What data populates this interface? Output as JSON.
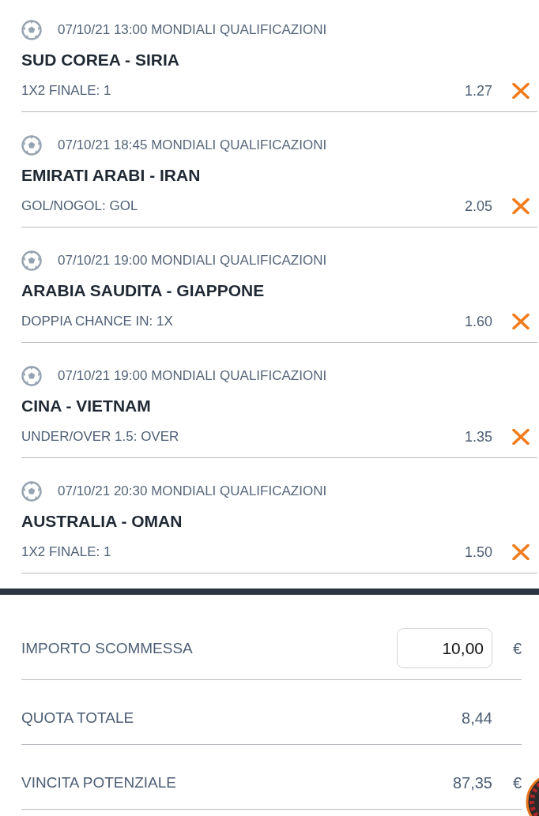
{
  "bets": [
    {
      "event": "07/10/21 13:00 MONDIALI QUALIFICAZIONI",
      "match": "SUD COREA - SIRIA",
      "market": "1X2 FINALE: 1",
      "odds": "1.27"
    },
    {
      "event": "07/10/21 18:45 MONDIALI QUALIFICAZIONI",
      "match": "EMIRATI ARABI - IRAN",
      "market": "GOL/NOGOL: GOL",
      "odds": "2.05"
    },
    {
      "event": "07/10/21 19:00 MONDIALI QUALIFICAZIONI",
      "match": "ARABIA SAUDITA - GIAPPONE",
      "market": "DOPPIA CHANCE IN: 1X",
      "odds": "1.60"
    },
    {
      "event": "07/10/21 19:00 MONDIALI QUALIFICAZIONI",
      "match": "CINA - VIETNAM",
      "market": "UNDER/OVER 1.5: OVER",
      "odds": "1.35"
    },
    {
      "event": "07/10/21 20:30 MONDIALI QUALIFICAZIONI",
      "match": "AUSTRALIA - OMAN",
      "market": "1X2 FINALE: 1",
      "odds": "1.50"
    }
  ],
  "summary": [
    {
      "kind": "input",
      "label": "IMPORTO SCOMMESSA",
      "value": "10,00",
      "currency": "€"
    },
    {
      "kind": "text",
      "label": "QUOTA TOTALE",
      "value": "8,44"
    },
    {
      "kind": "text",
      "label": "VINCITA POTENZIALE",
      "value": "87,35",
      "currency": "€"
    }
  ]
}
